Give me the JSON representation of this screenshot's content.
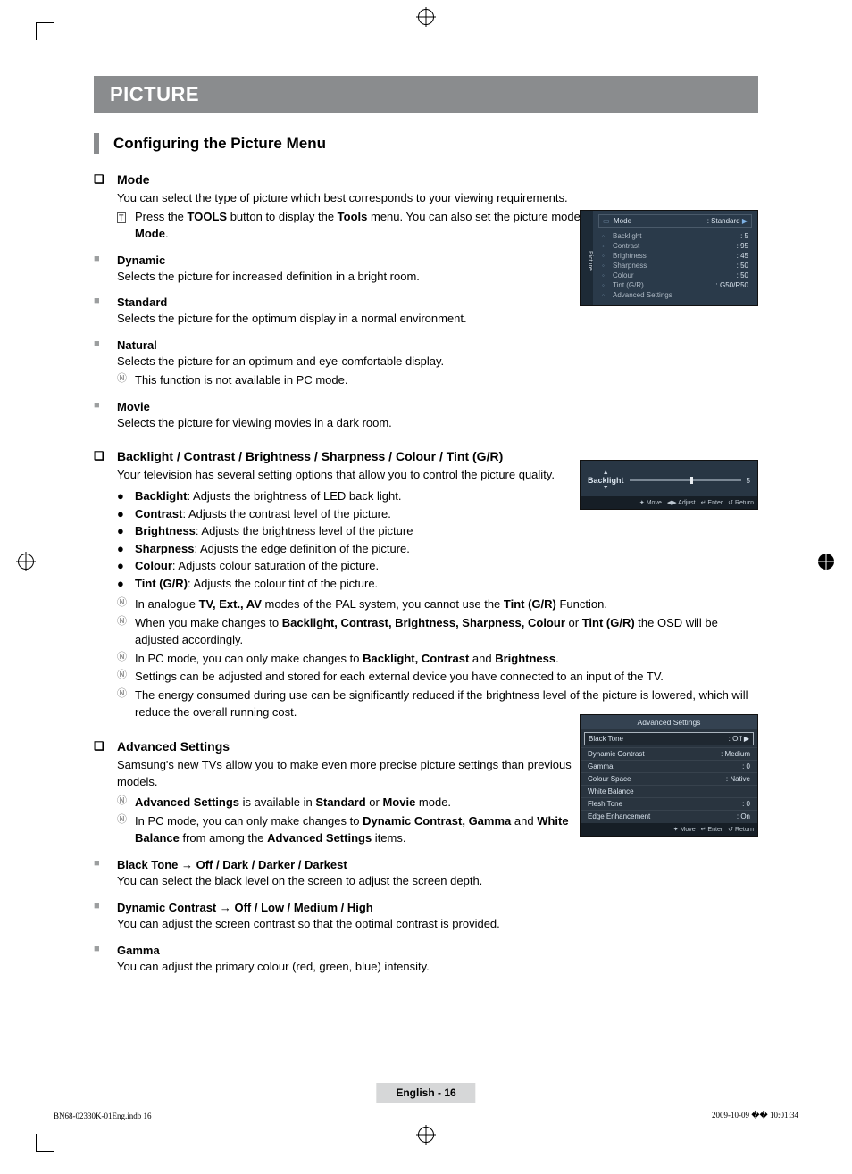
{
  "banner": "PICTURE",
  "h2": "Configuring the Picture Menu",
  "mode": {
    "title": "Mode",
    "intro": "You can select the type of picture which best corresponds to your viewing requirements.",
    "tool_note_pre": "Press the ",
    "tool_note_b1": "TOOLS",
    "tool_note_mid": " button to display the ",
    "tool_note_b2": "Tools",
    "tool_note_mid2": " menu. You can also set the picture mode by selecting ",
    "tool_note_b3": "Tools → Picture Mode",
    "tool_note_end": "."
  },
  "dynamic": {
    "title": "Dynamic",
    "body": "Selects the picture for increased definition in a bright room."
  },
  "standard": {
    "title": "Standard",
    "body": "Selects the picture for the optimum display in a normal environment."
  },
  "natural": {
    "title": "Natural",
    "body": "Selects the picture for an optimum and eye-comfortable display.",
    "note": "This function is not available in PC mode."
  },
  "movie": {
    "title": "Movie",
    "body": "Selects the picture for viewing movies in a dark room."
  },
  "adjust": {
    "title": "Backlight / Contrast / Brightness / Sharpness / Colour / Tint (G/R)",
    "intro": "Your television has several setting options that allow you to control the picture quality.",
    "bullets": [
      {
        "b": "Backlight",
        "t": ": Adjusts the brightness of LED back light."
      },
      {
        "b": "Contrast",
        "t": ": Adjusts the contrast level of the picture."
      },
      {
        "b": "Brightness",
        "t": ": Adjusts the brightness level of the picture"
      },
      {
        "b": "Sharpness",
        "t": ": Adjusts the edge definition of the picture."
      },
      {
        "b": "Colour",
        "t": ": Adjusts colour saturation of the picture."
      },
      {
        "b": "Tint (G/R)",
        "t": ": Adjusts the colour tint of the picture."
      }
    ],
    "n1_a": "In analogue ",
    "n1_b": "TV, Ext., AV",
    "n1_c": " modes of the PAL system, you cannot use the ",
    "n1_d": "Tint (G/R)",
    "n1_e": " Function.",
    "n2_a": "When you make changes to ",
    "n2_b": "Backlight, Contrast, Brightness, Sharpness, Colour",
    "n2_c": " or ",
    "n2_d": "Tint (G/R)",
    "n2_e": " the OSD will be adjusted accordingly.",
    "n3_a": "In PC mode, you can only make changes to ",
    "n3_b": "Backlight, Contrast",
    "n3_c": " and ",
    "n3_d": "Brightness",
    "n3_e": ".",
    "n4": "Settings can be adjusted and stored for each external device you have connected to an input of the TV.",
    "n5": "The energy consumed during use can be significantly reduced if the brightness level of the picture is lowered, which will reduce the overall running cost."
  },
  "advanced": {
    "title": "Advanced Settings",
    "intro": "Samsung's new TVs allow you to make even more precise picture settings than previous models.",
    "n1_a": "Advanced Settings",
    "n1_b": " is available in ",
    "n1_c": "Standard",
    "n1_d": " or ",
    "n1_e": "Movie",
    "n1_f": " mode.",
    "n2_a": "In PC mode, you can only make changes to ",
    "n2_b": "Dynamic Contrast, Gamma",
    "n2_c": " and ",
    "n2_d": "White Balance",
    "n2_e": " from among the ",
    "n2_f": "Advanced Settings",
    "n2_g": " items."
  },
  "blacktone": {
    "title": "Black Tone → Off / Dark / Darker / Darkest",
    "body": "You can select the black level on the screen to adjust the screen depth."
  },
  "dyncontrast": {
    "title": "Dynamic Contrast → Off / Low / Medium / High",
    "body": "You can adjust the screen contrast so that the optimal contrast is provided."
  },
  "gamma": {
    "title": "Gamma",
    "body": "You can adjust the primary colour (red, green, blue) intensity."
  },
  "osd1": {
    "tab": "Picture",
    "head_l": "Mode",
    "head_r": ": Standard",
    "rows": [
      {
        "l": "Backlight",
        "r": ": 5"
      },
      {
        "l": "Contrast",
        "r": ": 95"
      },
      {
        "l": "Brightness",
        "r": ": 45"
      },
      {
        "l": "Sharpness",
        "r": ": 50"
      },
      {
        "l": "Colour",
        "r": ": 50"
      },
      {
        "l": "Tint (G/R)",
        "r": ": G50/R50"
      },
      {
        "l": "Advanced Settings",
        "r": ""
      }
    ]
  },
  "osd2": {
    "label": "Backlight",
    "value": "5",
    "nav": [
      "Move",
      "Adjust",
      "Enter",
      "Return"
    ]
  },
  "osd3": {
    "title": "Advanced Settings",
    "rows": [
      {
        "l": "Black Tone",
        "r": ": Off",
        "first": true
      },
      {
        "l": "Dynamic Contrast",
        "r": ": Medium"
      },
      {
        "l": "Gamma",
        "r": ": 0"
      },
      {
        "l": "Colour Space",
        "r": ": Native"
      },
      {
        "l": "White Balance",
        "r": ""
      },
      {
        "l": "Flesh Tone",
        "r": ": 0"
      },
      {
        "l": "Edge Enhancement",
        "r": ": On"
      }
    ],
    "nav": [
      "Move",
      "Enter",
      "Return"
    ]
  },
  "footer": {
    "center": "English - 16",
    "left": "BN68-02330K-01Eng.indb   16",
    "right": "2009-10-09   �� 10:01:34"
  }
}
